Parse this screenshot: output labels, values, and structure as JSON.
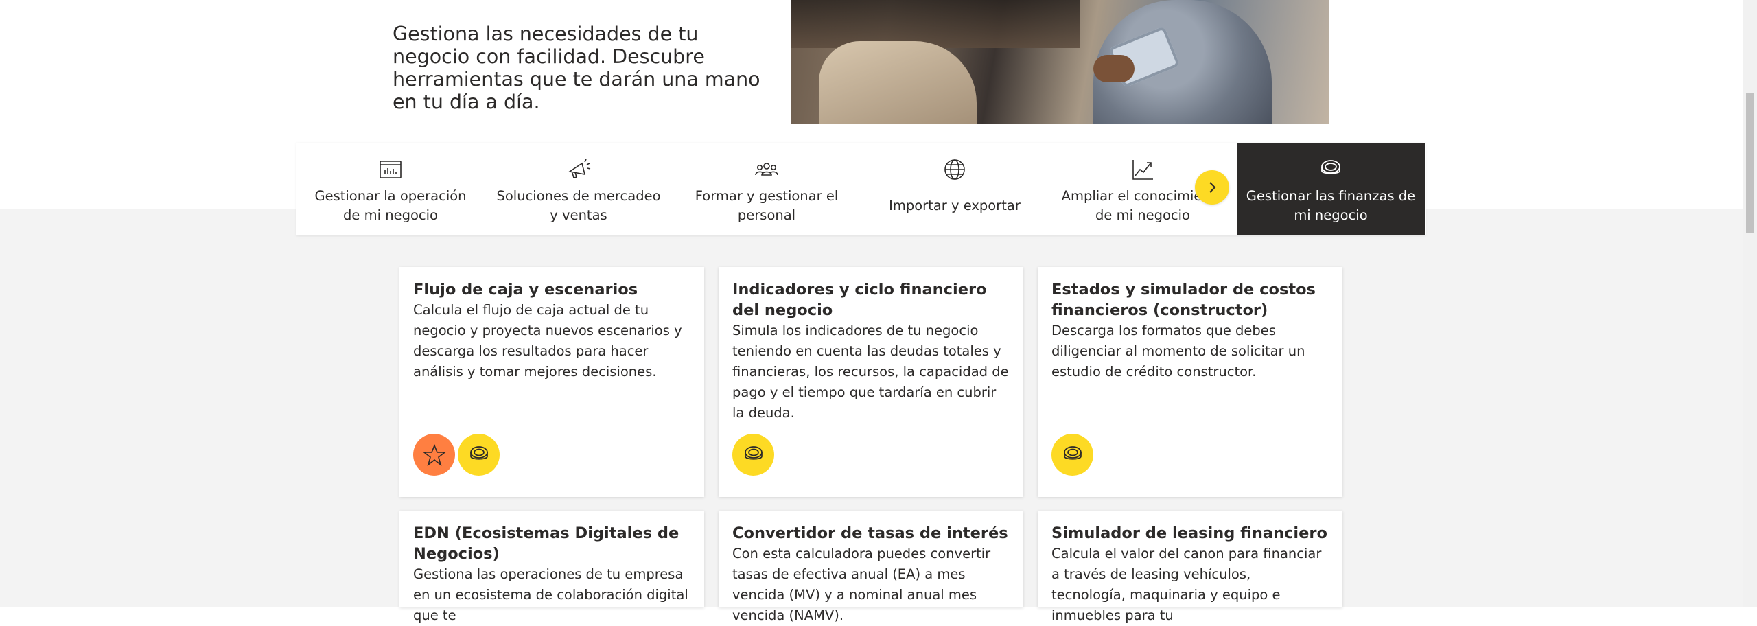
{
  "hero": {
    "description": "Gestiona las necesidades de tu negocio con facilidad. Descubre herramientas que te darán una mano en tu día a día."
  },
  "categories": [
    {
      "label": "Gestionar la operación de mi negocio",
      "icon": "dashboard-icon",
      "active": false
    },
    {
      "label": "Soluciones de mercadeo y ventas",
      "icon": "megaphone-icon",
      "active": false
    },
    {
      "label": "Formar y gestionar el personal",
      "icon": "team-icon",
      "active": false
    },
    {
      "label": "Importar y exportar",
      "icon": "globe-icon",
      "active": false
    },
    {
      "label": "Ampliar el conocimiento de mi negocio",
      "icon": "growth-chart-icon",
      "active": false
    },
    {
      "label": "Gestionar las finanzas de mi negocio",
      "icon": "coins-icon",
      "active": true
    }
  ],
  "carousel": {
    "next_icon": "chevron-right-icon"
  },
  "cards": [
    {
      "title": "Flujo de caja y escenarios",
      "description": "Calcula el flujo de caja actual de tu negocio y proyecta nuevos escenarios y descarga los resultados para hacer análisis y tomar mejores decisiones.",
      "badges": [
        "star-icon",
        "coins-icon"
      ]
    },
    {
      "title": "Indicadores y ciclo financiero del negocio",
      "description": "Simula los indicadores de tu negocio teniendo en cuenta las deudas totales y financieras, los recursos, la capacidad de pago y el tiempo que tardaría en cubrir la deuda.",
      "badges": [
        "coins-icon"
      ]
    },
    {
      "title": "Estados y simulador de costos financieros (constructor)",
      "description": "Descarga los formatos que debes diligenciar al momento de solicitar un estudio de crédito constructor.",
      "badges": [
        "coins-icon"
      ]
    },
    {
      "title": "EDN (Ecosistemas Digitales de Negocios)",
      "description": "Gestiona las operaciones de tu empresa en un ecosistema de colaboración digital que te",
      "badges": []
    },
    {
      "title": "Convertidor de tasas de interés",
      "description": "Con esta calculadora puedes convertir tasas de efectiva anual (EA) a mes vencida (MV) y a nominal anual mes vencida (NAMV).",
      "badges": []
    },
    {
      "title": "Simulador de leasing financiero",
      "description": "Calcula el valor del canon para financiar a través de leasing vehículos, tecnología, maquinaria y equipo e inmuebles para tu",
      "badges": []
    }
  ],
  "colors": {
    "accent_yellow": "#fdda24",
    "accent_orange": "#ff7f41",
    "dark": "#2c2a29",
    "page_grey": "#f3f3f3"
  }
}
